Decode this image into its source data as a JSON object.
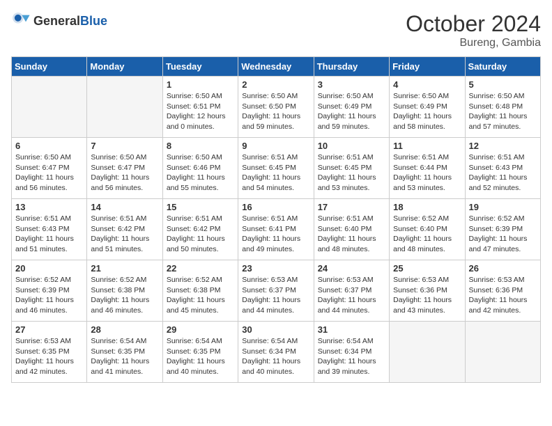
{
  "header": {
    "logo_general": "General",
    "logo_blue": "Blue",
    "month": "October 2024",
    "location": "Bureng, Gambia"
  },
  "weekdays": [
    "Sunday",
    "Monday",
    "Tuesday",
    "Wednesday",
    "Thursday",
    "Friday",
    "Saturday"
  ],
  "weeks": [
    [
      {
        "day": "",
        "empty": true
      },
      {
        "day": "",
        "empty": true
      },
      {
        "day": "1",
        "sunrise": "6:50 AM",
        "sunset": "6:51 PM",
        "daylight": "12 hours and 0 minutes."
      },
      {
        "day": "2",
        "sunrise": "6:50 AM",
        "sunset": "6:50 PM",
        "daylight": "11 hours and 59 minutes."
      },
      {
        "day": "3",
        "sunrise": "6:50 AM",
        "sunset": "6:49 PM",
        "daylight": "11 hours and 59 minutes."
      },
      {
        "day": "4",
        "sunrise": "6:50 AM",
        "sunset": "6:49 PM",
        "daylight": "11 hours and 58 minutes."
      },
      {
        "day": "5",
        "sunrise": "6:50 AM",
        "sunset": "6:48 PM",
        "daylight": "11 hours and 57 minutes."
      }
    ],
    [
      {
        "day": "6",
        "sunrise": "6:50 AM",
        "sunset": "6:47 PM",
        "daylight": "11 hours and 56 minutes."
      },
      {
        "day": "7",
        "sunrise": "6:50 AM",
        "sunset": "6:47 PM",
        "daylight": "11 hours and 56 minutes."
      },
      {
        "day": "8",
        "sunrise": "6:50 AM",
        "sunset": "6:46 PM",
        "daylight": "11 hours and 55 minutes."
      },
      {
        "day": "9",
        "sunrise": "6:51 AM",
        "sunset": "6:45 PM",
        "daylight": "11 hours and 54 minutes."
      },
      {
        "day": "10",
        "sunrise": "6:51 AM",
        "sunset": "6:45 PM",
        "daylight": "11 hours and 53 minutes."
      },
      {
        "day": "11",
        "sunrise": "6:51 AM",
        "sunset": "6:44 PM",
        "daylight": "11 hours and 53 minutes."
      },
      {
        "day": "12",
        "sunrise": "6:51 AM",
        "sunset": "6:43 PM",
        "daylight": "11 hours and 52 minutes."
      }
    ],
    [
      {
        "day": "13",
        "sunrise": "6:51 AM",
        "sunset": "6:43 PM",
        "daylight": "11 hours and 51 minutes."
      },
      {
        "day": "14",
        "sunrise": "6:51 AM",
        "sunset": "6:42 PM",
        "daylight": "11 hours and 51 minutes."
      },
      {
        "day": "15",
        "sunrise": "6:51 AM",
        "sunset": "6:42 PM",
        "daylight": "11 hours and 50 minutes."
      },
      {
        "day": "16",
        "sunrise": "6:51 AM",
        "sunset": "6:41 PM",
        "daylight": "11 hours and 49 minutes."
      },
      {
        "day": "17",
        "sunrise": "6:51 AM",
        "sunset": "6:40 PM",
        "daylight": "11 hours and 48 minutes."
      },
      {
        "day": "18",
        "sunrise": "6:52 AM",
        "sunset": "6:40 PM",
        "daylight": "11 hours and 48 minutes."
      },
      {
        "day": "19",
        "sunrise": "6:52 AM",
        "sunset": "6:39 PM",
        "daylight": "11 hours and 47 minutes."
      }
    ],
    [
      {
        "day": "20",
        "sunrise": "6:52 AM",
        "sunset": "6:39 PM",
        "daylight": "11 hours and 46 minutes."
      },
      {
        "day": "21",
        "sunrise": "6:52 AM",
        "sunset": "6:38 PM",
        "daylight": "11 hours and 46 minutes."
      },
      {
        "day": "22",
        "sunrise": "6:52 AM",
        "sunset": "6:38 PM",
        "daylight": "11 hours and 45 minutes."
      },
      {
        "day": "23",
        "sunrise": "6:53 AM",
        "sunset": "6:37 PM",
        "daylight": "11 hours and 44 minutes."
      },
      {
        "day": "24",
        "sunrise": "6:53 AM",
        "sunset": "6:37 PM",
        "daylight": "11 hours and 44 minutes."
      },
      {
        "day": "25",
        "sunrise": "6:53 AM",
        "sunset": "6:36 PM",
        "daylight": "11 hours and 43 minutes."
      },
      {
        "day": "26",
        "sunrise": "6:53 AM",
        "sunset": "6:36 PM",
        "daylight": "11 hours and 42 minutes."
      }
    ],
    [
      {
        "day": "27",
        "sunrise": "6:53 AM",
        "sunset": "6:35 PM",
        "daylight": "11 hours and 42 minutes."
      },
      {
        "day": "28",
        "sunrise": "6:54 AM",
        "sunset": "6:35 PM",
        "daylight": "11 hours and 41 minutes."
      },
      {
        "day": "29",
        "sunrise": "6:54 AM",
        "sunset": "6:35 PM",
        "daylight": "11 hours and 40 minutes."
      },
      {
        "day": "30",
        "sunrise": "6:54 AM",
        "sunset": "6:34 PM",
        "daylight": "11 hours and 40 minutes."
      },
      {
        "day": "31",
        "sunrise": "6:54 AM",
        "sunset": "6:34 PM",
        "daylight": "11 hours and 39 minutes."
      },
      {
        "day": "",
        "empty": true
      },
      {
        "day": "",
        "empty": true
      }
    ]
  ],
  "labels": {
    "sunrise_prefix": "Sunrise: ",
    "sunset_prefix": "Sunset: ",
    "daylight_prefix": "Daylight: "
  }
}
